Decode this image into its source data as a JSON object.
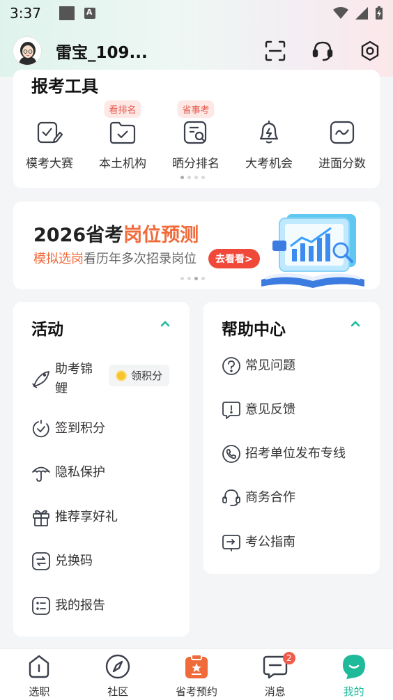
{
  "status_bar": {
    "time": "3:37"
  },
  "header": {
    "user_name": "雷宝_109..."
  },
  "tools": {
    "title": "报考工具",
    "items": [
      {
        "label": "模考大赛",
        "icon": "pencil-check-icon",
        "badge": ""
      },
      {
        "label": "本土机构",
        "icon": "folder-check-icon",
        "badge": "看排名"
      },
      {
        "label": "晒分排名",
        "icon": "search-doc-icon",
        "badge": "省事考"
      },
      {
        "label": "大考机会",
        "icon": "bell-icon",
        "badge": ""
      },
      {
        "label": "进面分数",
        "icon": "trend-icon",
        "badge": ""
      }
    ]
  },
  "banner": {
    "title_prefix": "2026省考",
    "title_highlight": "岗位预测",
    "subtitle_highlight": "模拟选岗",
    "subtitle_rest": "看历年多次招录岗位",
    "button_label": "去看看>"
  },
  "activity": {
    "title": "活动",
    "items": [
      {
        "label": "助考锦鲤",
        "icon": "koi-icon"
      },
      {
        "label": "签到积分",
        "icon": "check-clock-icon"
      },
      {
        "label": "隐私保护",
        "icon": "umbrella-icon"
      },
      {
        "label": "推荐享好礼",
        "icon": "gift-icon"
      },
      {
        "label": "兑换码",
        "icon": "exchange-icon"
      },
      {
        "label": "我的报告",
        "icon": "list-report-icon"
      }
    ],
    "coin_chip_label": "领积分"
  },
  "help": {
    "title": "帮助中心",
    "items": [
      {
        "label": "常见问题",
        "icon": "question-icon"
      },
      {
        "label": "意见反馈",
        "icon": "feedback-icon"
      },
      {
        "label": "招考单位发布专线",
        "icon": "phone-icon"
      },
      {
        "label": "商务合作",
        "icon": "headset-icon"
      },
      {
        "label": "考公指南",
        "icon": "guide-icon"
      }
    ]
  },
  "tabbar": {
    "tabs": [
      {
        "label": "选职",
        "icon": "shield-info-icon",
        "active": false
      },
      {
        "label": "社区",
        "icon": "compass-icon",
        "active": false
      },
      {
        "label": "省考预约",
        "icon": "clipboard-star-icon",
        "active": false
      },
      {
        "label": "消息",
        "icon": "message-icon",
        "active": false,
        "badge": "2"
      },
      {
        "label": "我的",
        "icon": "smile-face-icon",
        "active": true
      }
    ]
  },
  "colors": {
    "accent": "#1fba9a",
    "highlight": "#f06a3a",
    "badge_red": "#f15b4a"
  }
}
